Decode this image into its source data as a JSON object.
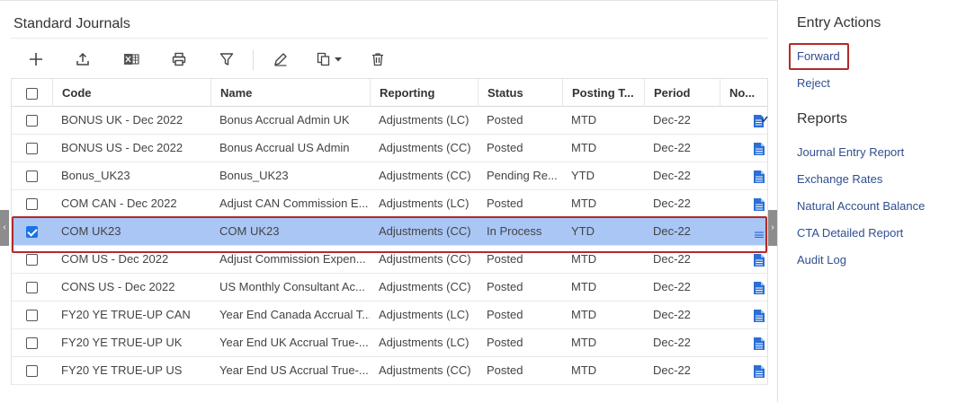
{
  "page": {
    "title": "Standard Journals"
  },
  "toolbar": {
    "icons": [
      "plus-icon",
      "upload-icon",
      "excel-icon",
      "print-icon",
      "filter-icon",
      "edit-icon",
      "copy-dropdown-icon",
      "delete-icon"
    ]
  },
  "grid": {
    "columns": [
      "Code",
      "Name",
      "Reporting",
      "Status",
      "Posting T...",
      "Period",
      "No..."
    ],
    "rows": [
      {
        "code": "BONUS UK - Dec 2022",
        "name": "Bonus Accrual Admin UK",
        "reporting": "Adjustments (LC)",
        "status": "Posted",
        "posting": "MTD",
        "period": "Dec-22",
        "checked": false,
        "note_icon": "note-check-icon"
      },
      {
        "code": "BONUS US - Dec 2022",
        "name": "Bonus Accrual US Admin",
        "reporting": "Adjustments (CC)",
        "status": "Posted",
        "posting": "MTD",
        "period": "Dec-22",
        "checked": false,
        "note_icon": "note-icon"
      },
      {
        "code": "Bonus_UK23",
        "name": "Bonus_UK23",
        "reporting": "Adjustments (CC)",
        "status": "Pending Re...",
        "posting": "YTD",
        "period": "Dec-22",
        "checked": false,
        "note_icon": "note-icon"
      },
      {
        "code": "COM CAN - Dec 2022",
        "name": "Adjust CAN Commission E...",
        "reporting": "Adjustments (LC)",
        "status": "Posted",
        "posting": "MTD",
        "period": "Dec-22",
        "checked": false,
        "note_icon": "note-icon"
      },
      {
        "code": "COM UK23",
        "name": "COM UK23",
        "reporting": "Adjustments (CC)",
        "status": "In Process",
        "posting": "YTD",
        "period": "Dec-22",
        "checked": true,
        "note_icon": "note-lines-icon"
      },
      {
        "code": "COM US - Dec 2022",
        "name": "Adjust Commission Expen...",
        "reporting": "Adjustments (CC)",
        "status": "Posted",
        "posting": "MTD",
        "period": "Dec-22",
        "checked": false,
        "note_icon": "note-icon"
      },
      {
        "code": "CONS US - Dec 2022",
        "name": "US Monthly Consultant Ac...",
        "reporting": "Adjustments (CC)",
        "status": "Posted",
        "posting": "MTD",
        "period": "Dec-22",
        "checked": false,
        "note_icon": "note-icon"
      },
      {
        "code": "FY20 YE TRUE-UP CAN",
        "name": "Year End Canada Accrual T...",
        "reporting": "Adjustments (LC)",
        "status": "Posted",
        "posting": "MTD",
        "period": "Dec-22",
        "checked": false,
        "note_icon": "note-icon"
      },
      {
        "code": "FY20 YE TRUE-UP UK",
        "name": "Year End UK Accrual True-...",
        "reporting": "Adjustments (LC)",
        "status": "Posted",
        "posting": "MTD",
        "period": "Dec-22",
        "checked": false,
        "note_icon": "note-icon"
      },
      {
        "code": "FY20 YE TRUE-UP US",
        "name": "Year End US Accrual True-...",
        "reporting": "Adjustments (CC)",
        "status": "Posted",
        "posting": "MTD",
        "period": "Dec-22",
        "checked": false,
        "note_icon": "note-icon"
      }
    ]
  },
  "sidebar": {
    "entry_actions": {
      "title": "Entry Actions",
      "items": [
        "Forward",
        "Reject"
      ]
    },
    "reports": {
      "title": "Reports",
      "items": [
        "Journal Entry Report",
        "Exchange Rates",
        "Natural Account Balance",
        "CTA Detailed Report",
        "Audit Log"
      ]
    }
  },
  "colors": {
    "selected_row": "#a9c6f5",
    "highlight_outline": "#b22a2a",
    "link": "#2f4f8f",
    "note_icon": "#2a6fd6"
  }
}
